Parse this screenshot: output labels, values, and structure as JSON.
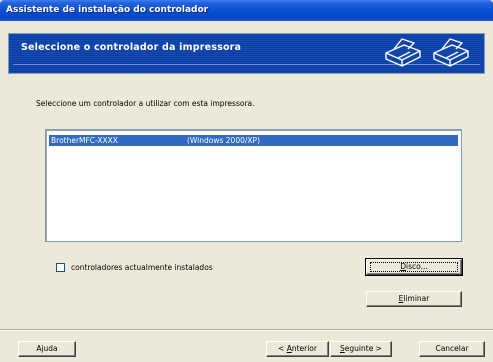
{
  "window": {
    "title": "Assistente de instalação do controlador"
  },
  "banner": {
    "title": "Seleccione o controlador da impressora",
    "icons": [
      "printer-icon",
      "printer-icon"
    ]
  },
  "prompt": "Seleccione um controlador a utilizar com esta impressora.",
  "driver_list": {
    "rows": [
      {
        "brand": "Brother",
        "model": "MFC-XXXX",
        "os": "(Windows 2000/XP)",
        "selected": true
      }
    ]
  },
  "options": {
    "installed_checkbox": {
      "label": "controladores actualmente instalados",
      "checked": false
    }
  },
  "buttons": {
    "disk": {
      "accel": "D",
      "rest": "isco..."
    },
    "remove": {
      "accel": "E",
      "rest": "liminar"
    },
    "help": "Ajuda",
    "back": {
      "prefix": "< ",
      "accel": "A",
      "rest": "nterior"
    },
    "next": {
      "accel": "S",
      "rest": "eguinte >"
    },
    "cancel": "Cancelar"
  },
  "colors": {
    "title_bar": "#0a4fd6",
    "banner": "#0a3fa8",
    "selection": "#316ac5",
    "dialog_bg": "#ece9d8"
  }
}
